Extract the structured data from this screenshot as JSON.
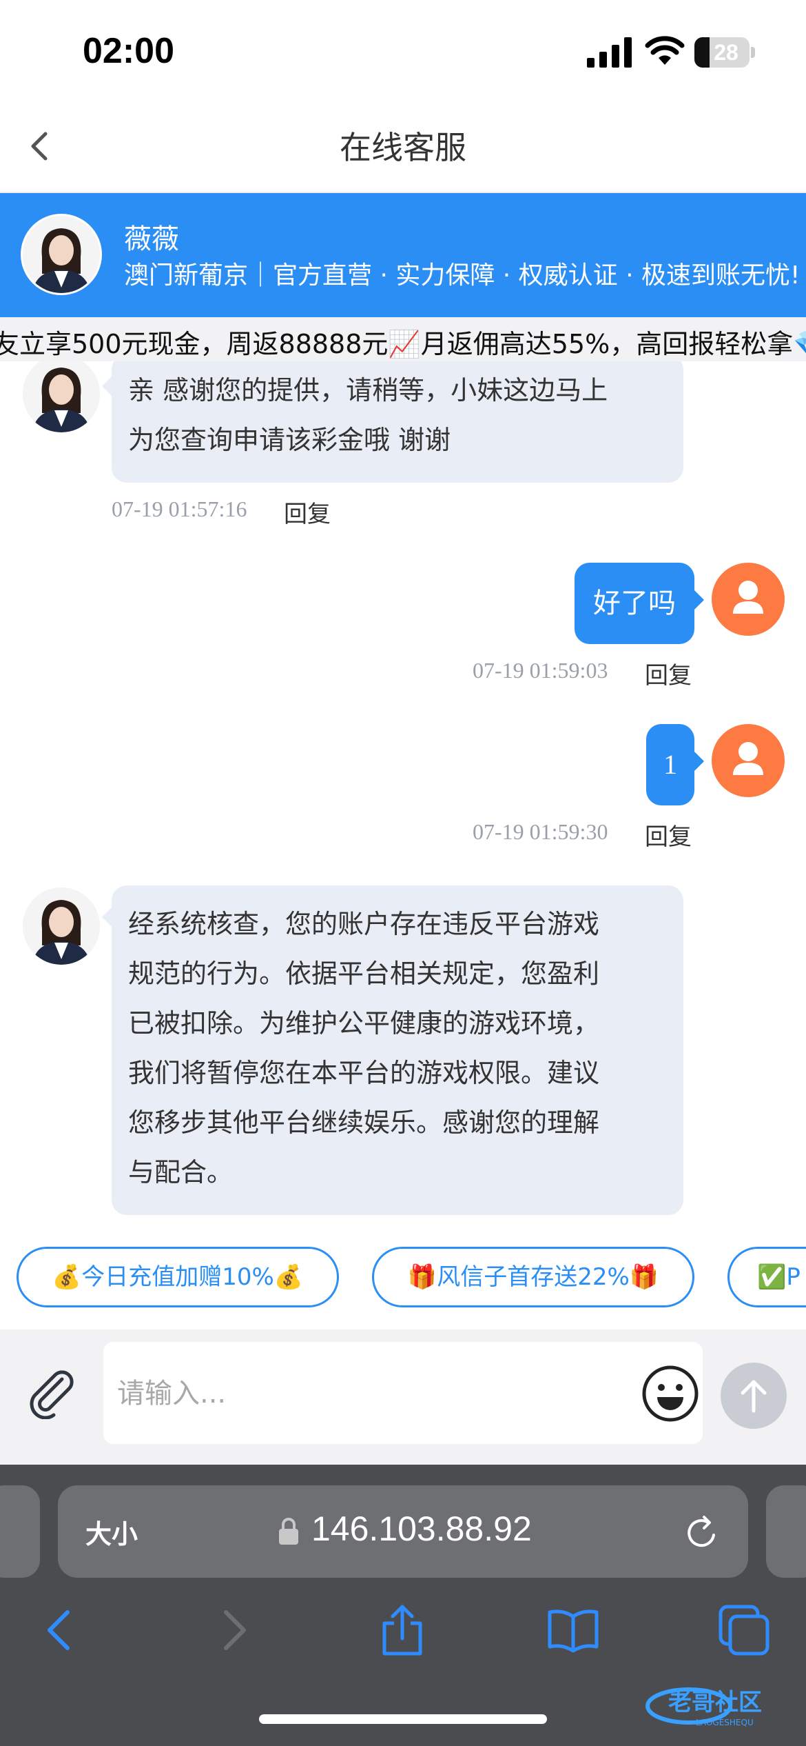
{
  "status_bar": {
    "time": "02:00",
    "battery": "28"
  },
  "nav": {
    "title": "在线客服"
  },
  "agent": {
    "name": "薇薇",
    "description": "澳门新葡京｜官方直营 · 实力保障 · 权威认证 · 极速到账无忧!"
  },
  "marquee": {
    "text": "友立享500元现金，周返88888元📈月返佣高达55%，高回报轻松拿💎"
  },
  "messages": [
    {
      "side": "left",
      "lines": [
        "亲 感谢您的提供，请稍等，小妹这边马上",
        "为您查询申请该彩金哦 谢谢"
      ],
      "time": "07-19 01:57:16",
      "reply": "回复"
    },
    {
      "side": "right",
      "text": "好了吗",
      "time": "07-19 01:59:03",
      "reply": "回复"
    },
    {
      "side": "right",
      "text": "1",
      "time": "07-19 01:59:30",
      "reply": "回复"
    },
    {
      "side": "left",
      "lines": [
        "经系统核查，您的账户存在违反平台游戏",
        "规范的行为。依据平台相关规定，您盈利",
        "已被扣除。为维护公平健康的游戏环境，",
        "我们将暂停您在本平台的游戏权限。建议",
        "您移步其他平台继续娱乐。感谢您的理解",
        "与配合。"
      ]
    }
  ],
  "quick_buttons": [
    "💰今日充值加赠10%💰",
    "🎁风信子首存送22%🎁",
    "✅P"
  ],
  "input": {
    "placeholder": "请输入..."
  },
  "safari": {
    "text_size": "大小",
    "url": "146.103.88.92"
  },
  "watermark": {
    "text": "老哥社区",
    "sub": "LAOGESHEQU"
  },
  "colors": {
    "accent": "#2b8ef5",
    "user_avatar": "#fe7a43",
    "agent_bubble": "#e9edf5"
  }
}
